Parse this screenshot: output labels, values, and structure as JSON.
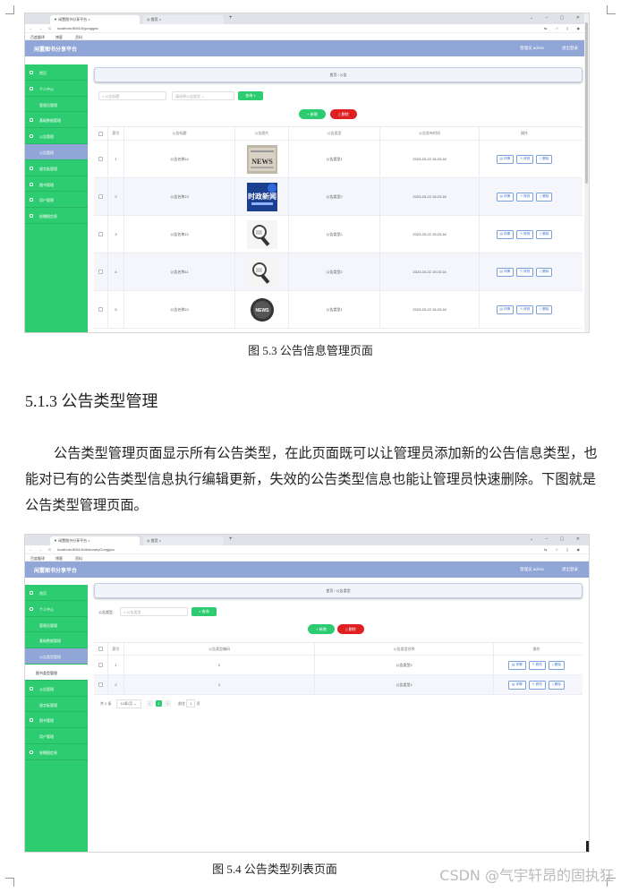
{
  "shot1": {
    "tabs": [
      "闲置图书分享平台",
      "首页"
    ],
    "url": "localhost:8081/#/gonggao",
    "bookmarks": [
      "百度翻译",
      "博客",
      "资料"
    ],
    "app_title": "闲置图书分享平台",
    "user_label": "管理员 admin",
    "logout": "退出登录",
    "sidebar": [
      "首页",
      "个人中心",
      "管理员管理",
      "基础数据管理",
      "公告管理",
      "公告管理",
      "留言板管理",
      "图书管理",
      "用户管理",
      "轮播图信息"
    ],
    "breadcrumb": "首页 / 公告",
    "search": {
      "title_placeholder": "公告标题",
      "type_placeholder": "请选择公告类型",
      "button": "查询"
    },
    "add_button": "新增",
    "delete_button": "删除",
    "columns": [
      "索引",
      "公告标题",
      "公告图片",
      "公告类型",
      "公告发布时间",
      "操作"
    ],
    "rows": [
      {
        "idx": "1",
        "title": "公告名称14",
        "type": "公告类型1",
        "time": "2023-03-22 15:23:18",
        "img": "news-paper"
      },
      {
        "idx": "2",
        "title": "公告名称13",
        "type": "公告类型2",
        "time": "2023-03-22 15:23:18",
        "img": "时政新闻"
      },
      {
        "idx": "3",
        "title": "公告名称12",
        "type": "公告类型2",
        "time": "2023-03-22 15:23:18",
        "img": "magnifier"
      },
      {
        "idx": "4",
        "title": "公告名称11",
        "type": "公告类型2",
        "time": "2023-03-22 15:23:18",
        "img": "magnifier"
      },
      {
        "idx": "5",
        "title": "公告名称10",
        "type": "公告类型1",
        "time": "2023-03-22 15:23:18",
        "img": "news-badge"
      }
    ],
    "row_ops": [
      "详情",
      "修改",
      "删除"
    ]
  },
  "caption1": "图 5.3 公告信息管理页面",
  "heading": "5.1.3 公告类型管理",
  "paragraph": "公告类型管理页面显示所有公告类型，在此页面既可以让管理员添加新的公告信息类型，也能对已有的公告类型信息执行编辑更新，失效的公告类型信息也能让管理员快速删除。下图就是公告类型管理页面。",
  "shot2": {
    "tabs": [
      "闲置图书分享平台",
      "首页"
    ],
    "url": "localhost:8081/#/dictionaryGonggao",
    "bookmarks": [
      "百度翻译",
      "博客",
      "资料"
    ],
    "app_title": "闲置图书分享平台",
    "user_label": "管理员 admin",
    "logout": "退出登录",
    "sidebar": [
      "首页",
      "个人中心",
      "管理员管理",
      "基础数据管理",
      "公告类型管理",
      "图书类型管理",
      "公告管理",
      "留言板管理",
      "图书管理",
      "用户管理",
      "轮播图信息"
    ],
    "breadcrumb": "首页 / 公告类型",
    "search": {
      "label": "公告类型",
      "placeholder": "公告类型",
      "button": "查询"
    },
    "add_button": "新增",
    "delete_button": "删除",
    "columns": [
      "索引",
      "公告类型编码",
      "公告类型名称",
      "操作"
    ],
    "rows": [
      {
        "idx": "1",
        "code": "2",
        "name": "公告类型2"
      },
      {
        "idx": "2",
        "code": "1",
        "name": "公告类型1"
      }
    ],
    "row_ops": [
      "详情",
      "修改",
      "删除"
    ],
    "pager": {
      "total": "共 2 条",
      "size": "10条/页",
      "page": "1",
      "goto": "前往",
      "page_input": "1",
      "unit": "页"
    }
  },
  "caption2": "图 5.4 公告类型列表页面",
  "watermark": "CSDN @气宇轩昂的固执狂",
  "colors": {
    "sidebar": "#2ecc71",
    "header": "#8fa6d6",
    "danger": "#e02020",
    "link": "#3b72d8"
  }
}
